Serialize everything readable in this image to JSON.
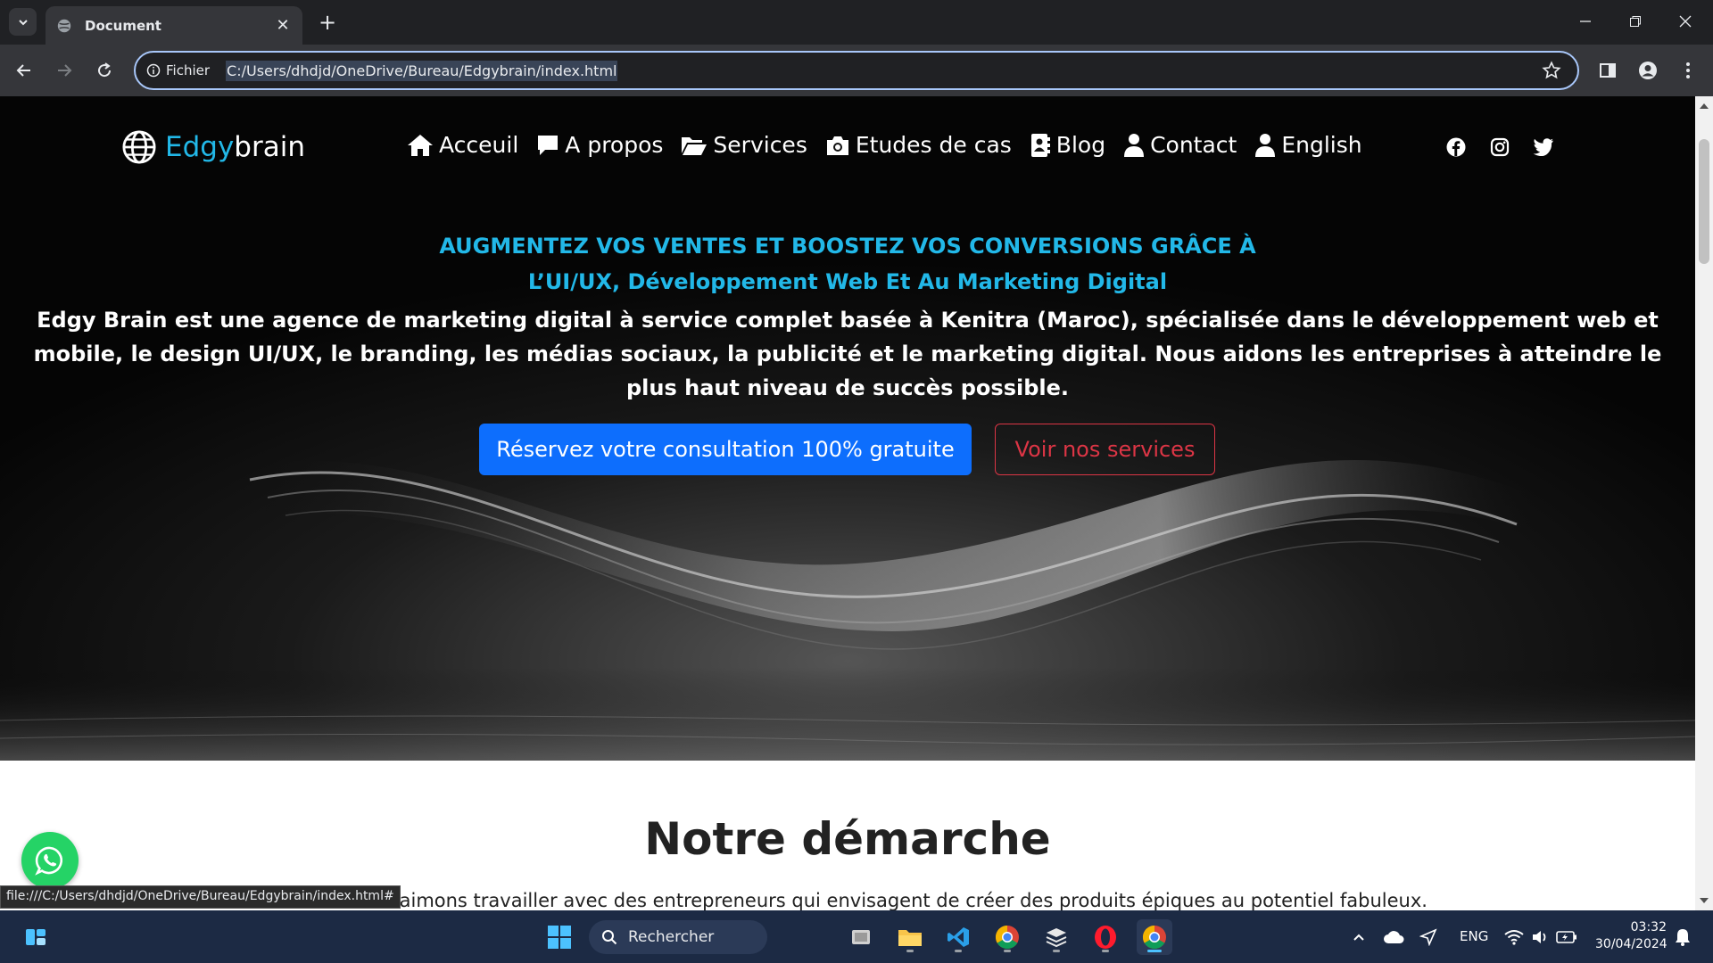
{
  "browser": {
    "tab_title": "Document",
    "site_chip_label": "Fichier",
    "url": "C:/Users/dhdjd/OneDrive/Bureau/Edgybrain/index.html",
    "status_url": "file:///C:/Users/dhdjd/OneDrive/Bureau/Edgybrain/index.html#"
  },
  "nav": {
    "brand_part1": "Edgy",
    "brand_part2": "brain",
    "items": [
      {
        "label": "Acceuil",
        "icon": "home-icon"
      },
      {
        "label": "A propos",
        "icon": "comment-icon"
      },
      {
        "label": "Services",
        "icon": "folder-open-icon"
      },
      {
        "label": "Etudes de cas",
        "icon": "camera-icon"
      },
      {
        "label": "Blog",
        "icon": "address-book-icon"
      },
      {
        "label": "Contact",
        "icon": "user-icon"
      },
      {
        "label": "English",
        "icon": "user-icon"
      }
    ],
    "social": [
      "facebook-icon",
      "instagram-icon",
      "twitter-icon"
    ]
  },
  "hero": {
    "title_line1": "AUGMENTEZ VOS VENTES ET BOOSTEZ VOS CONVERSIONS GRÂCE À",
    "title_line2": "L’UI/UX, Développement Web Et Au Marketing Digital",
    "description": "Edgy Brain est une agence de marketing digital à service complet basée à Kenitra (Maroc), spécialisée dans le développement web et mobile, le design UI/UX, le branding, les médias sociaux, la publicité et le marketing digital. Nous aidons les entreprises à atteindre le plus haut niveau de succès possible.",
    "primary_button": "Réservez votre consultation 100% gratuite",
    "secondary_button": "Voir nos services"
  },
  "section": {
    "title": "Notre démarche",
    "text": "s aimons travailler avec des entrepreneurs qui envisagent de créer des produits épiques au potentiel fabuleux."
  },
  "taskbar": {
    "search_label": "Rechercher",
    "language": "ENG",
    "time": "03:32",
    "date": "30/04/2024"
  },
  "colors": {
    "accent_cyan": "#22b8e8",
    "primary_blue": "#0d6efd",
    "outline_red": "#dc3545",
    "whatsapp_green": "#25d366"
  }
}
